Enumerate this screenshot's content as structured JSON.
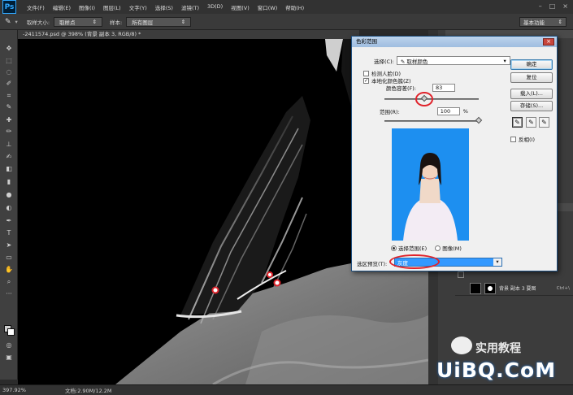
{
  "app": {
    "logo": "Ps",
    "menu": [
      "文件(F)",
      "编辑(E)",
      "图像(I)",
      "图层(L)",
      "文字(Y)",
      "选择(S)",
      "滤镜(T)",
      "3D(D)",
      "视图(V)",
      "窗口(W)",
      "帮助(H)"
    ],
    "window_controls": [
      "–",
      "□",
      "×"
    ]
  },
  "options_bar": {
    "sample_size_label": "取样大小:",
    "sample_size_value": "取样点",
    "sample_label": "样本:",
    "sample_value": "所有图层",
    "workspace_value": "基本功能"
  },
  "document": {
    "tab_title": "-2411574.psd @ 398% (背景 副本 3, RGB/8) *"
  },
  "status_bar": {
    "zoom": "397.92%",
    "doc_info": "文档:2.90M/12.2M"
  },
  "layers": [
    {
      "name": "背景 副本 3 要图",
      "shortcut": "Ctrl+\\"
    }
  ],
  "dialog": {
    "title": "色彩范围",
    "select_label": "选择(C):",
    "select_value": "取样颜色",
    "detect_faces_label": "检测人脸(D)",
    "detect_faces_checked": false,
    "localized_label": "本地化颜色簇(Z)",
    "localized_checked": true,
    "fuzziness_label": "颜色容差(F):",
    "fuzziness_value": "83",
    "range_label": "范围(R):",
    "range_value": "100",
    "range_unit": "%",
    "fuzziness_fraction": 0.42,
    "range_fraction": 1.0,
    "radio_selection": "选择范围(E)",
    "radio_image": "图像(M)",
    "radio_selected": "selection",
    "preview_label": "选区预览(T):",
    "preview_value": "灰度",
    "buttons": {
      "ok": "确定",
      "reset": "复位",
      "load": "载入(L)...",
      "save": "存储(S)..."
    },
    "invert_label": "反相(I)",
    "invert_checked": false
  },
  "watermark": {
    "brand": "实用教程",
    "site": "UiBQ.CoM"
  },
  "colors": {
    "annotation": "#e0232b",
    "preview_bg": "#1d8ff0",
    "selection_highlight": "#3399ff"
  }
}
